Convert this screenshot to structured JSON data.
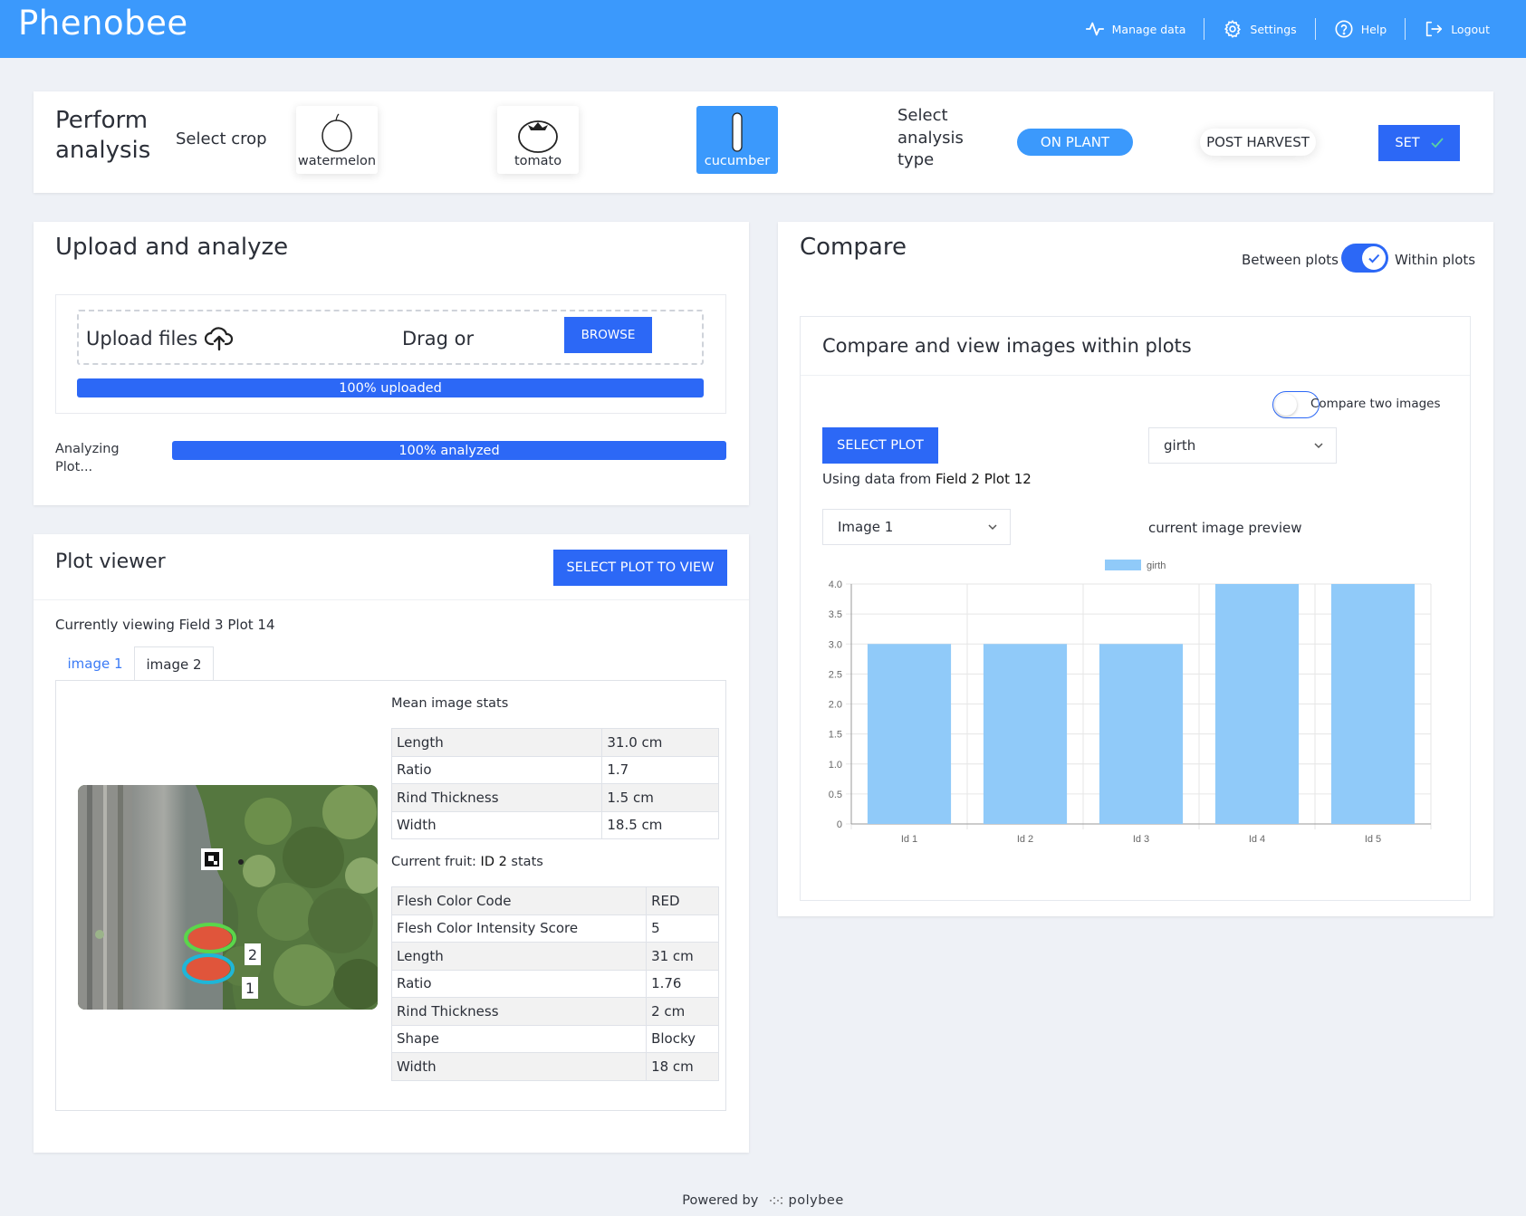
{
  "app": {
    "brand": "Phenobee"
  },
  "nav": [
    {
      "label": "Manage data",
      "icon": "activity-icon"
    },
    {
      "label": "Settings",
      "icon": "gear-icon"
    },
    {
      "label": "Help",
      "icon": "help-icon"
    },
    {
      "label": "Logout",
      "icon": "logout-icon"
    }
  ],
  "perform": {
    "title": "Perform analysis",
    "select_crop": "Select crop",
    "crops": [
      "watermelon",
      "tomato",
      "cucumber"
    ],
    "active_crop": "cucumber",
    "select_type": "Select analysis type",
    "on_plant": "ON PLANT",
    "post_harvest": "POST HARVEST",
    "set": "SET"
  },
  "upload": {
    "title": "Upload and analyze",
    "upload_files": "Upload files",
    "drag_or": "Drag or",
    "browse": "BROWSE",
    "uploaded": "100% uploaded",
    "uploaded_progress": 1.0,
    "analyzing": "Analyzing Plot...",
    "analyzed": "100% analyzed",
    "analyzed_progress": 1.0
  },
  "plot_viewer": {
    "title": "Plot viewer",
    "select_button": "SELECT PLOT TO VIEW",
    "viewing": "Currently viewing Field 3 Plot 14",
    "tabs": [
      "image 1",
      "image 2"
    ],
    "active_tab": "image 1",
    "photo_labels": [
      "2",
      "1"
    ],
    "mean_label": "Mean image stats",
    "mean_stats": [
      [
        "Length",
        "31.0 cm"
      ],
      [
        "Ratio",
        "1.7"
      ],
      [
        "Rind Thickness",
        "1.5 cm"
      ],
      [
        "Width",
        "18.5 cm"
      ]
    ],
    "current_label_prefix": "Current fruit: ",
    "current_label_id": "ID 2",
    "current_label_suffix": " stats",
    "current_stats": [
      [
        "Flesh Color Code",
        "RED"
      ],
      [
        "Flesh Color Intensity Score",
        "5"
      ],
      [
        "Length",
        "31 cm"
      ],
      [
        "Ratio",
        "1.76"
      ],
      [
        "Rind Thickness",
        "2 cm"
      ],
      [
        "Shape",
        "Blocky"
      ],
      [
        "Width",
        "18 cm"
      ]
    ]
  },
  "compare": {
    "title": "Compare",
    "between": "Between plots",
    "within": "Within plots",
    "within_on": true,
    "inner_title": "Compare and view images within plots",
    "compare_two": "Compare two images",
    "compare_two_on": false,
    "select_plot": "SELECT PLOT",
    "metric": "girth",
    "using_prefix": "Using data from ",
    "using_plot": "Field 2 Plot 12",
    "image_select": "Image 1",
    "preview": "current image preview"
  },
  "chart_data": {
    "type": "bar",
    "categories": [
      "Id 1",
      "Id 2",
      "Id 3",
      "Id 4",
      "Id 5"
    ],
    "series": [
      {
        "name": "girth",
        "values": [
          3.0,
          3.0,
          3.0,
          4.0,
          4.0
        ],
        "color": "#90caf9"
      }
    ],
    "yticks": [
      "0",
      "0.5",
      "1.0",
      "1.5",
      "2.0",
      "2.5",
      "3.0",
      "3.5",
      "4.0"
    ],
    "ylim": [
      0,
      4.0
    ],
    "grid": true,
    "legend": "top-center"
  },
  "footer": {
    "powered_by": "Powered by",
    "logo_text": "polybee"
  },
  "colors": {
    "header": "#3b99fc",
    "primary": "#2c68f6",
    "bar": "#90caf9"
  }
}
